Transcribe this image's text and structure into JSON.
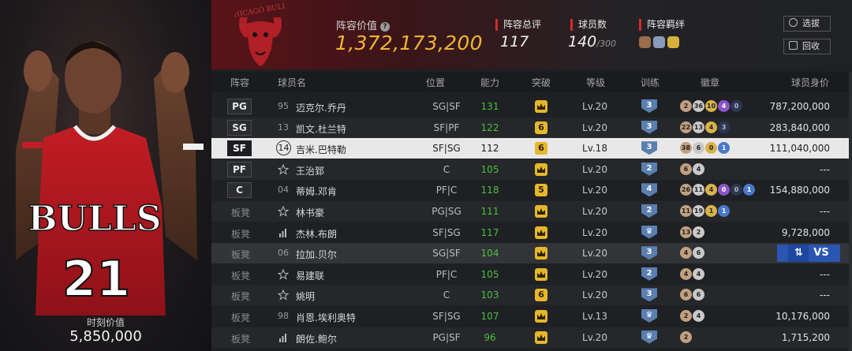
{
  "player_panel": {
    "jersey_team": "BULLS",
    "jersey_number": "21",
    "worth_label": "时刻价值",
    "worth_value": "5,850,000"
  },
  "header": {
    "logo_text": "CHICAGO BULLS",
    "lineup_value_label": "阵容价值",
    "lineup_value": "1,372,173,200",
    "stats": [
      {
        "label": "阵容总评",
        "value": "117"
      },
      {
        "label": "球员数",
        "value": "140",
        "sub": "/300"
      },
      {
        "label": "阵容羁绊"
      }
    ],
    "buttons": {
      "select": "选拔",
      "recycle": "回收"
    }
  },
  "columns": [
    "阵容",
    "球员名",
    "位置",
    "能力",
    "突破",
    "等级",
    "训练",
    "徽章",
    "球员身价"
  ],
  "rows": [
    {
      "slot": "PG",
      "num": "95",
      "name": "迈克尔.乔丹",
      "pos": "SG|SF",
      "ability": "131",
      "breakthrough": "crown",
      "level": "Lv.20",
      "train": "3",
      "badges": [
        {
          "t": "b-bronze",
          "v": "2"
        },
        {
          "t": "b-silver",
          "v": "36"
        },
        {
          "t": "b-gold",
          "v": "10"
        },
        {
          "t": "b-purple",
          "v": "4"
        },
        {
          "t": "b-navy",
          "v": "0"
        }
      ],
      "value": "787,200,000"
    },
    {
      "slot": "SG",
      "num": "13",
      "name": "凯文.杜兰特",
      "pos": "SF|PF",
      "ability": "122",
      "breakthrough": "6",
      "level": "Lv.20",
      "train": "3",
      "badges": [
        {
          "t": "b-bronze",
          "v": "22"
        },
        {
          "t": "b-silver",
          "v": "13"
        },
        {
          "t": "b-gold",
          "v": "4"
        },
        {
          "t": "b-navy",
          "v": "3"
        }
      ],
      "value": "283,840,000"
    },
    {
      "slot": "SF",
      "num": "14",
      "name": "吉米.巴特勒",
      "pos": "SF|SG",
      "ability": "112",
      "breakthrough": "6",
      "level": "Lv.18",
      "train": "3",
      "badges": [
        {
          "t": "b-bronze",
          "v": "38"
        },
        {
          "t": "b-silver",
          "v": "6"
        },
        {
          "t": "b-gold",
          "v": "0"
        },
        {
          "t": "b-blue",
          "v": "1"
        }
      ],
      "value": "111,040,000"
    },
    {
      "slot": "PF",
      "icon": "star",
      "name": "王治郅",
      "pos": "C",
      "ability": "105",
      "breakthrough": "crown",
      "level": "Lv.20",
      "train": "2",
      "badges": [
        {
          "t": "b-bronze",
          "v": "6"
        },
        {
          "t": "b-silver",
          "v": "4"
        }
      ],
      "value": "---"
    },
    {
      "slot": "C",
      "num": "04",
      "name": "蒂姆.邓肯",
      "pos": "PF|C",
      "ability": "118",
      "breakthrough": "5",
      "level": "Lv.20",
      "train": "4",
      "badges": [
        {
          "t": "b-bronze",
          "v": "26"
        },
        {
          "t": "b-silver",
          "v": "11"
        },
        {
          "t": "b-gold",
          "v": "4"
        },
        {
          "t": "b-purple",
          "v": "0"
        },
        {
          "t": "b-navy",
          "v": "0"
        },
        {
          "t": "b-blue",
          "v": "1"
        }
      ],
      "value": "154,880,000"
    },
    {
      "slot": "板凳",
      "icon": "star",
      "name": "林书豪",
      "pos": "PG|SG",
      "ability": "111",
      "breakthrough": "crown",
      "level": "Lv.20",
      "train": "2",
      "badges": [
        {
          "t": "b-bronze",
          "v": "11"
        },
        {
          "t": "b-silver",
          "v": "19"
        },
        {
          "t": "b-gold",
          "v": "1"
        },
        {
          "t": "b-blue",
          "v": "1"
        }
      ],
      "value": "---"
    },
    {
      "slot": "板凳",
      "icon": "bars",
      "name": "杰林.布朗",
      "pos": "SF|SG",
      "ability": "117",
      "breakthrough": "crown",
      "level": "Lv.20",
      "train": "crown",
      "badges": [
        {
          "t": "b-bronze",
          "v": "13"
        },
        {
          "t": "b-silver",
          "v": "2"
        }
      ],
      "value": "9,728,000"
    },
    {
      "slot": "板凳",
      "num": "06",
      "name": "拉加.贝尔",
      "pos": "SG|SF",
      "ability": "104",
      "breakthrough": "crown",
      "level": "Lv.20",
      "train": "3",
      "badges": [
        {
          "t": "b-bronze",
          "v": "4"
        },
        {
          "t": "b-silver",
          "v": "6"
        }
      ],
      "value": "",
      "vs": "VS"
    },
    {
      "slot": "板凳",
      "icon": "star",
      "name": "易建联",
      "pos": "PF|C",
      "ability": "105",
      "breakthrough": "crown",
      "level": "Lv.20",
      "train": "2",
      "badges": [
        {
          "t": "b-bronze",
          "v": "4"
        },
        {
          "t": "b-silver",
          "v": "4"
        }
      ],
      "value": "---"
    },
    {
      "slot": "板凳",
      "icon": "star",
      "name": "姚明",
      "pos": "C",
      "ability": "103",
      "breakthrough": "6",
      "level": "Lv.20",
      "train": "3",
      "badges": [
        {
          "t": "b-bronze",
          "v": "6"
        },
        {
          "t": "b-silver",
          "v": "6"
        }
      ],
      "value": "---"
    },
    {
      "slot": "板凳",
      "num": "98",
      "name": "肖恩.埃利奥特",
      "pos": "SF|SG",
      "ability": "107",
      "breakthrough": "crown",
      "level": "Lv.13",
      "train": "crown",
      "badges": [
        {
          "t": "b-bronze",
          "v": "2"
        },
        {
          "t": "b-silver",
          "v": "4"
        }
      ],
      "value": "10,176,000"
    },
    {
      "slot": "板凳",
      "icon": "bars",
      "name": "朗佐.鲍尔",
      "pos": "PG|SF",
      "ability": "96",
      "breakthrough": "crown",
      "level": "Lv.20",
      "train": "crown",
      "badges": [
        {
          "t": "b-bronze",
          "v": "2"
        }
      ],
      "value": "1,715,200"
    }
  ]
}
